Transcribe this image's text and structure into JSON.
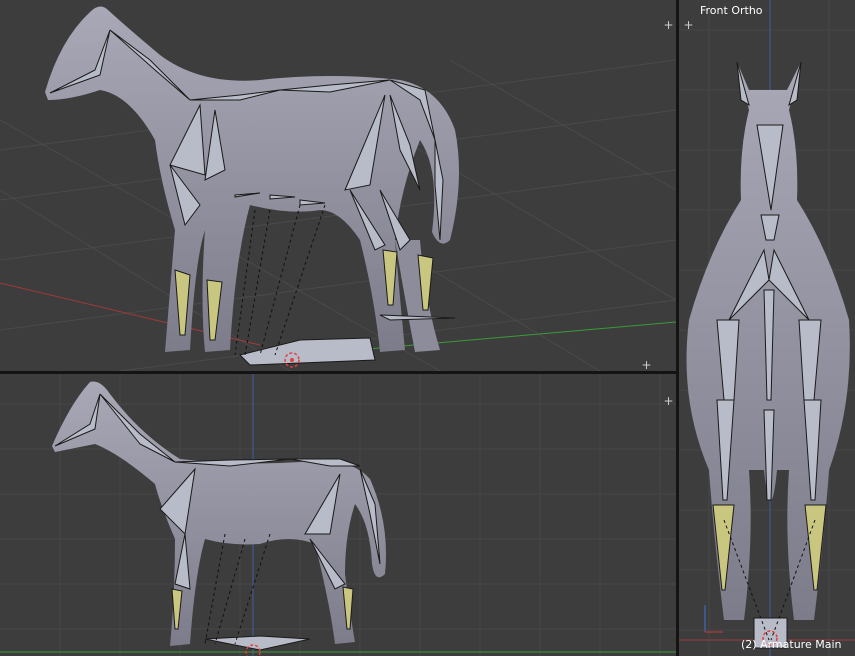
{
  "viewports": {
    "front": {
      "label": "Front Ortho",
      "object_info": "(2) Armature Main"
    }
  },
  "colors": {
    "viewport_bg": "#3d3d3d",
    "grid": "#4a4a4a",
    "mesh": "#9a9aa8",
    "mesh_shadow": "#6e6e7a",
    "bone": "#b8bcc8",
    "bone_outline": "#1a1a1a",
    "bone_selected": "#c9c680",
    "x_axis": "#a03a3a",
    "y_axis": "#3a9a3a",
    "z_axis": "#4060a0"
  },
  "icons": {
    "corner_widget": "plus-icon",
    "cursor": "3d-cursor-icon",
    "axes": "axis-gizmo-icon"
  }
}
